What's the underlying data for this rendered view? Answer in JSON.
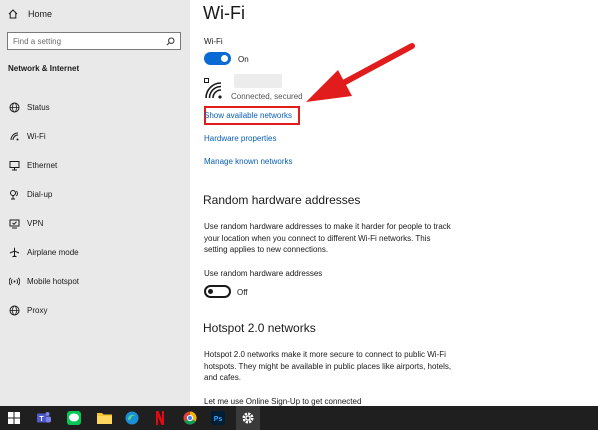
{
  "sidebar": {
    "home_label": "Home",
    "search_placeholder": "Find a setting",
    "section_title": "Network & Internet",
    "items": [
      {
        "label": "Status",
        "icon": "status-globe-icon"
      },
      {
        "label": "Wi-Fi",
        "icon": "wifi-icon"
      },
      {
        "label": "Ethernet",
        "icon": "ethernet-icon"
      },
      {
        "label": "Dial-up",
        "icon": "dialup-icon"
      },
      {
        "label": "VPN",
        "icon": "vpn-icon"
      },
      {
        "label": "Airplane mode",
        "icon": "airplane-icon"
      },
      {
        "label": "Mobile hotspot",
        "icon": "hotspot-icon"
      },
      {
        "label": "Proxy",
        "icon": "proxy-globe-icon"
      }
    ]
  },
  "main": {
    "title": "Wi-Fi",
    "wifi_label": "Wi-Fi",
    "wifi_state": "On",
    "network_status": "Connected, secured",
    "links": {
      "show_available": "Show available networks",
      "hardware_properties": "Hardware properties",
      "manage_known": "Manage known networks"
    },
    "random_hw": {
      "heading": "Random hardware addresses",
      "description": "Use random hardware addresses to make it harder for people to track your location when you connect to different Wi-Fi networks. This setting applies to new connections.",
      "toggle_label": "Use random hardware addresses",
      "toggle_state": "Off"
    },
    "hotspot": {
      "heading": "Hotspot 2.0 networks",
      "description": "Hotspot 2.0 networks make it more secure to connect to public Wi-Fi hotspots. They might be available in public places like airports, hotels, and cafes.",
      "signup_label": "Let me use Online Sign-Up to get connected"
    }
  },
  "colors": {
    "accent": "#0a6ad3",
    "link": "#0a5fb8",
    "highlight": "#e11c1c",
    "sidebar_bg": "#e9e9e9",
    "taskbar_bg": "#1f1f1f"
  },
  "taskbar": {
    "icons": [
      "windows-start-icon",
      "teams-icon",
      "line-icon",
      "file-explorer-icon",
      "edge-icon",
      "netflix-icon",
      "chrome-icon",
      "photoshop-icon",
      "settings-icon"
    ]
  }
}
